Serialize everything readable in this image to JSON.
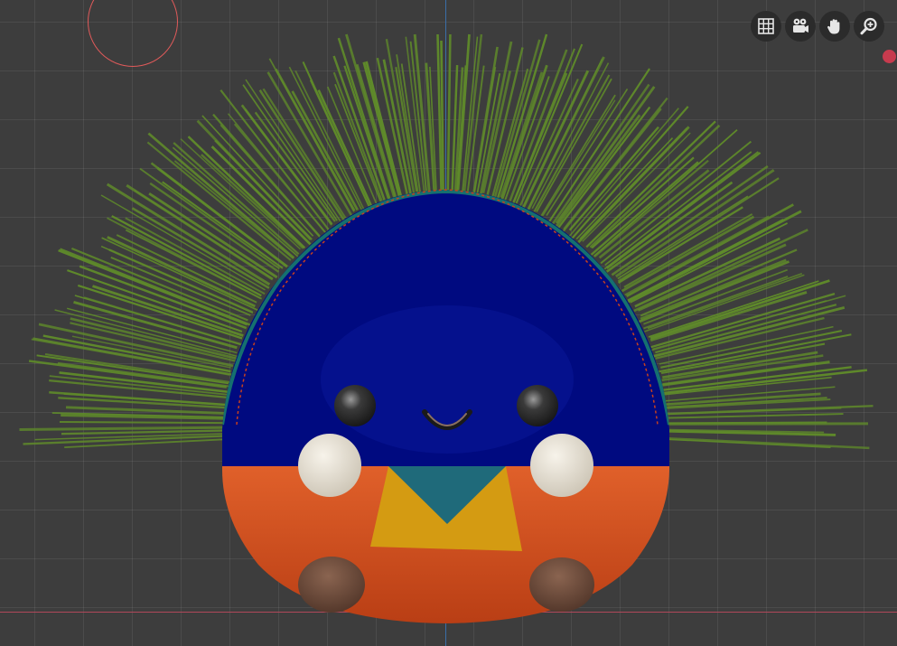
{
  "viewport": {
    "background_color": "#3d3d3d",
    "grid_color": "#4a4a4a",
    "axis_x_color": "#b0485a",
    "axis_y_color": "#3a6ea8"
  },
  "navigation_gizmo": [
    {
      "name": "toggle-grid",
      "icon": "grid-icon"
    },
    {
      "name": "toggle-camera-view",
      "icon": "camera-icon"
    },
    {
      "name": "pan-view",
      "icon": "hand-icon"
    },
    {
      "name": "zoom-view",
      "icon": "zoom-icon"
    }
  ],
  "overlay": {
    "selection_circle_color": "#e05a5a",
    "record_dot_color": "#c73b4e"
  },
  "model": {
    "body_top_color": "#000a80",
    "body_bottom_color": "#d8501c",
    "hair_color": "#5f8a2a",
    "collar_color": "#d49b12",
    "neck_color": "#1f6a7a",
    "cheek_color": "#e5ded0",
    "eye_color": "#2b2b2b",
    "foot_color": "#6b4634"
  }
}
